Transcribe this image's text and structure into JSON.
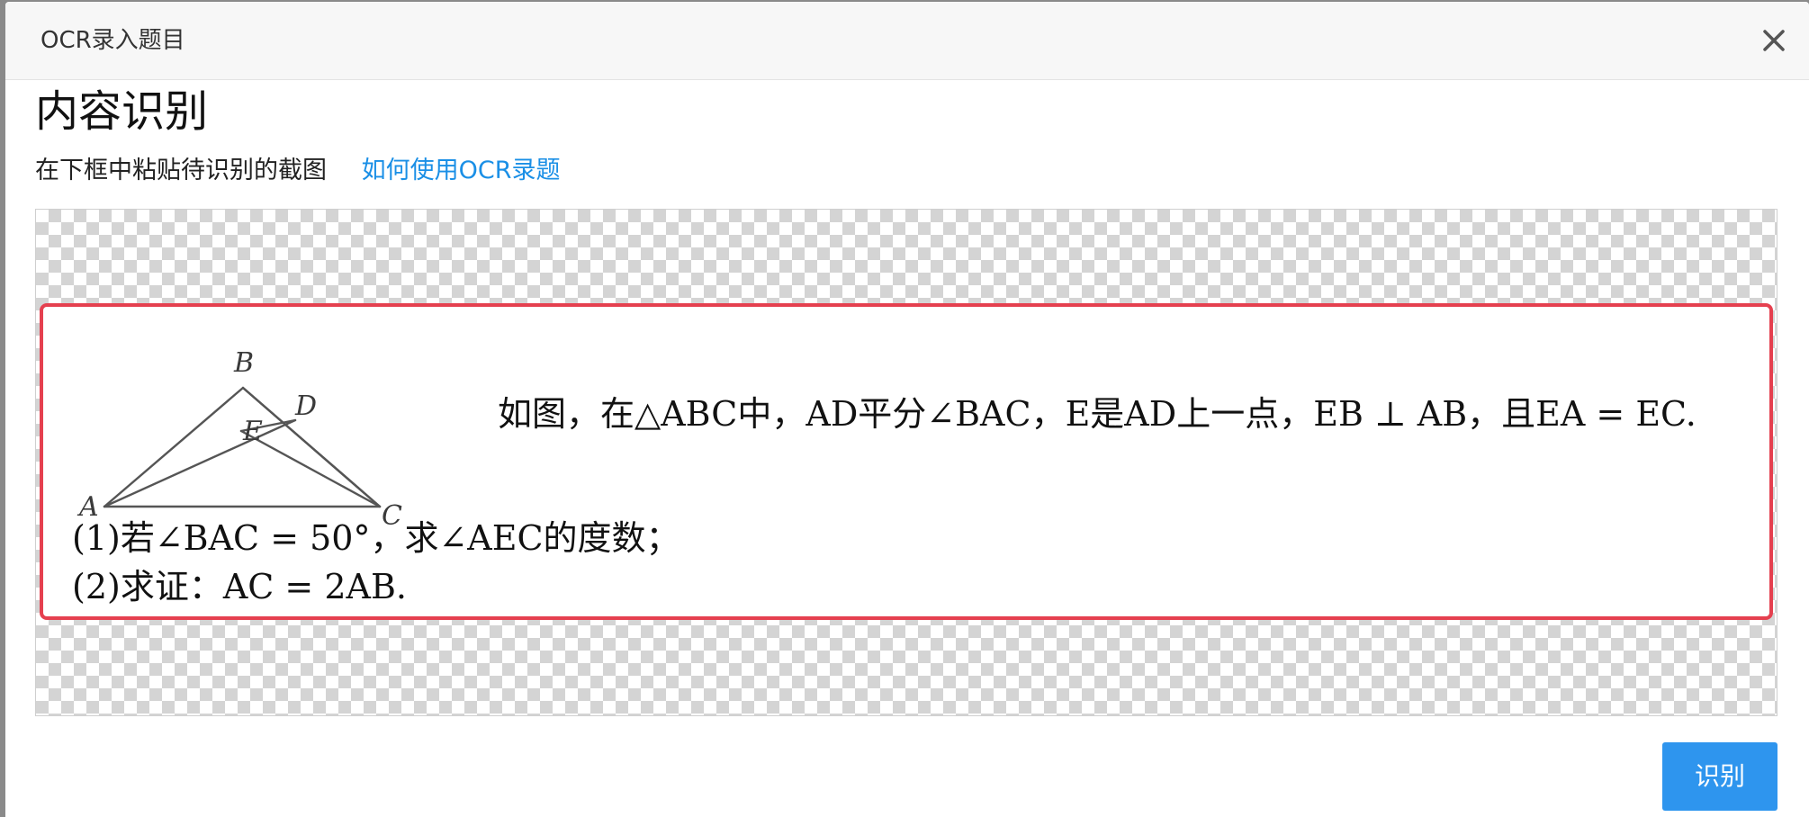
{
  "dialog": {
    "title": "OCR录入题目",
    "close_icon": "close-icon"
  },
  "section": {
    "title": "内容识别",
    "hint": "在下框中粘贴待识别的截图",
    "help_link": "如何使用OCR录题"
  },
  "pasted": {
    "figure_labels": {
      "a": "A",
      "b": "B",
      "c": "C",
      "d": "D",
      "e": "E"
    },
    "question_main": "如图，在△ABC中，AD平分∠BAC，E是AD上一点，EB ⊥ AB，且EA = EC.",
    "question_1": "(1)若∠BAC = 50°，求∠AEC的度数；",
    "question_2": "(2)求证：AC = 2AB."
  },
  "actions": {
    "recognize_label": "识别"
  },
  "colors": {
    "accent_blue": "#2e95ee",
    "link_blue": "#1a8fe6",
    "selection_red": "#e5404f"
  }
}
